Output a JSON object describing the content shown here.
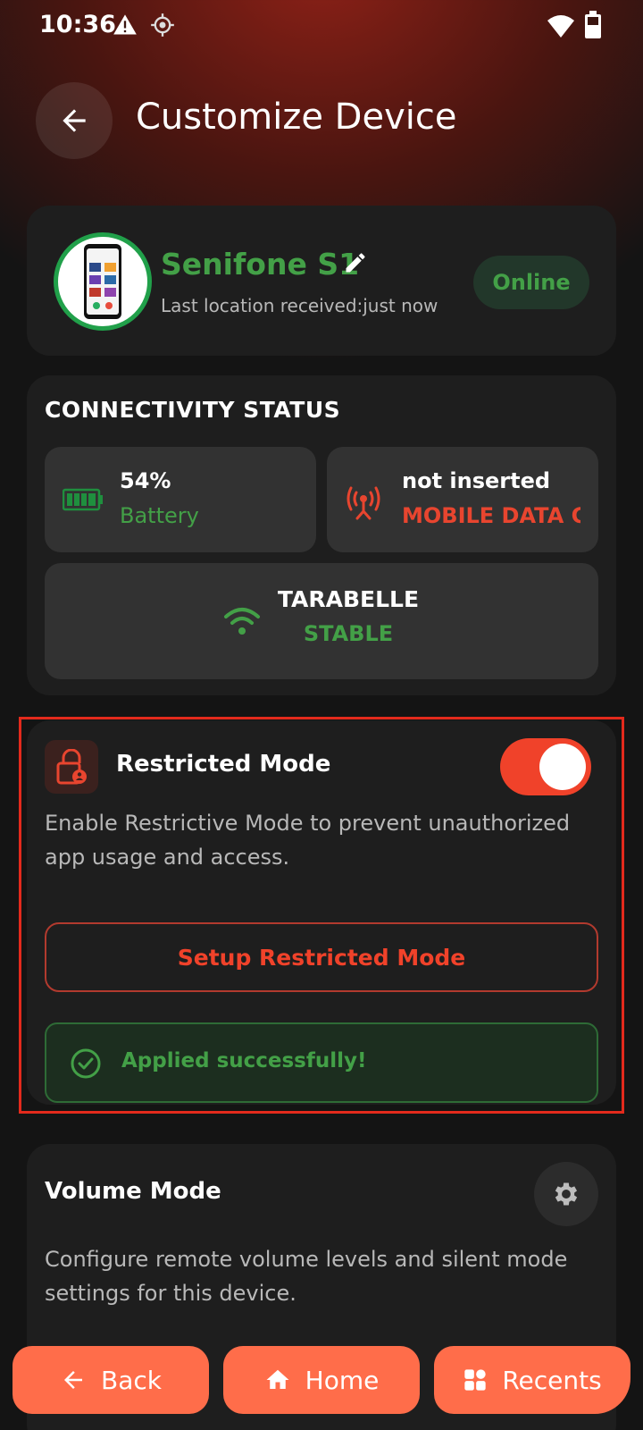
{
  "status_bar": {
    "time": "10:36",
    "icons": [
      "warning-icon",
      "location-icon",
      "wifi-icon",
      "battery-icon"
    ]
  },
  "header": {
    "title": "Customize Device",
    "back_icon": "arrow-left-icon"
  },
  "device": {
    "name": "Senifone S1",
    "last_location": "Last location received:just now",
    "status": "Online"
  },
  "connectivity": {
    "title": "CONNECTIVITY STATUS",
    "battery": {
      "value": "54%",
      "label": "Battery"
    },
    "mobile": {
      "value": "not inserted",
      "label": "MOBILE DATA C"
    },
    "wifi": {
      "name": "TARABELLE",
      "status": "STABLE"
    }
  },
  "restricted_mode": {
    "title": "Restricted Mode",
    "enabled": true,
    "description": "Enable Restrictive Mode to prevent unauthorized app usage and access.",
    "setup_button": "Setup Restricted Mode",
    "success_message": "Applied successfully!"
  },
  "volume_mode": {
    "title": "Volume Mode",
    "description": "Configure remote volume levels and silent mode settings for this device."
  },
  "bottom_nav": {
    "back": "Back",
    "home": "Home",
    "recents": "Recents"
  },
  "colors": {
    "accent_red": "#f0422a",
    "accent_green": "#43a047",
    "nav_orange": "#ff6d4a"
  }
}
